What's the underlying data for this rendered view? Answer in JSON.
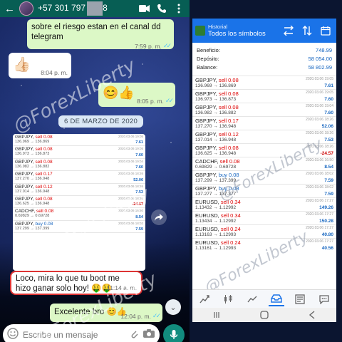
{
  "chat": {
    "header": {
      "phone": "+57 301 797",
      "phone_tail": "8"
    },
    "messages": [
      {
        "text": "sobre el riesgo estan en el canal dd telegram",
        "time": "7:59 p. m."
      },
      {
        "emoji": "👍🏻",
        "time": "8:04 p. m."
      },
      {
        "emoji": "😊👍",
        "time": "8:05 p. m."
      }
    ],
    "date_chip": "6 DE MARZO DE 2020",
    "screenshot_trades": [
      {
        "pair": "GBPJPY",
        "side": "sell 0.08",
        "prices": "136.969 → 136.869",
        "datetime": "2020.03.06 19:05",
        "profit": "7.61"
      },
      {
        "pair": "GBPJPY",
        "side": "sell 0.08",
        "prices": "136.973 → 136.873",
        "datetime": "2020.03.06 19:05",
        "profit": "7.60"
      },
      {
        "pair": "GBPJPY",
        "side": "sell 0.08",
        "prices": "136.982 → 136.882",
        "datetime": "2020.03.06 19:04",
        "profit": "7.60"
      },
      {
        "pair": "GBPJPY",
        "side": "sell 0.17",
        "prices": "137.270 → 136.948",
        "datetime": "2020.03.06 18:26",
        "profit": "52.06"
      },
      {
        "pair": "GBPJPY",
        "side": "sell 0.12",
        "prices": "137.014 → 136.948",
        "datetime": "2020.03.06 18:26",
        "profit": "7.53"
      },
      {
        "pair": "GBPJPY",
        "side": "sell 0.08",
        "prices": "136.625 → 136.948",
        "datetime": "2020.03.06 18:26",
        "profit": "-24.57"
      },
      {
        "pair": "CADCHF",
        "side": "sell 0.08",
        "prices": "0.69829 → 0.69728",
        "datetime": "2020.03.06 16:50",
        "profit": "8.54"
      },
      {
        "pair": "GBPJPY",
        "side": "buy 0.08",
        "prices": "137.299 → 137.399",
        "datetime": "2020.03.06 18:02",
        "profit": "7.59"
      }
    ],
    "reply": {
      "text": "Loco, mira lo que tu boot me hizo ganar solo hoy! 🤑🤑",
      "time": "11:14 a. m."
    },
    "answer": {
      "text": "Excelente bro 😊👍",
      "time": "12:04 p. m."
    },
    "input_placeholder": "Escribe un mensaje",
    "watermark": "@ForexLiberty"
  },
  "mt4": {
    "header": {
      "subtitle": "Historial",
      "title": "Todos los símbolos"
    },
    "summary": [
      {
        "label": "Beneficio:",
        "value": "748.99"
      },
      {
        "label": "Depósito:",
        "value": "58 054.00"
      },
      {
        "label": "Balance:",
        "value": "58 802.99"
      }
    ],
    "trades": [
      {
        "pair": "GBPJPY",
        "side": "sell 0.08",
        "prices": "136.969 → 136.869",
        "datetime": "2020.03.06 19:05",
        "profit": "7.61"
      },
      {
        "pair": "GBPJPY",
        "side": "sell 0.08",
        "prices": "136.973 → 136.873",
        "datetime": "2020.03.06 19:05",
        "profit": "7.60"
      },
      {
        "pair": "GBPJPY",
        "side": "sell 0.08",
        "prices": "136.982 → 136.882",
        "datetime": "2020.03.06 19:04",
        "profit": "7.60"
      },
      {
        "pair": "GBPJPY",
        "side": "sell 0.17",
        "prices": "137.270 → 136.948",
        "datetime": "2020.03.06 18:26",
        "profit": "52.06"
      },
      {
        "pair": "GBPJPY",
        "side": "sell 0.12",
        "prices": "137.014 → 136.948",
        "datetime": "2020.03.06 18:26",
        "profit": "7.53"
      },
      {
        "pair": "GBPJPY",
        "side": "sell 0.08",
        "prices": "136.625 → 136.948",
        "datetime": "2020.03.06 18:26",
        "profit": "-24.57"
      },
      {
        "pair": "CADCHF",
        "side": "sell 0.08",
        "prices": "0.69829 → 0.69728",
        "datetime": "2020.03.06 16:50",
        "profit": "8.54"
      },
      {
        "pair": "GBPJPY",
        "side": "buy 0.08",
        "prices": "137.299 → 137.399",
        "datetime": "2020.03.06 18:02",
        "profit": "7.59"
      },
      {
        "pair": "GBPJPY",
        "side": "buy 0.08",
        "prices": "137.277 → 137.377",
        "datetime": "2020.03.06 18:02",
        "profit": "7.59"
      },
      {
        "pair": "EURUSD",
        "side": "sell 0.34",
        "prices": "1.13432 → 1.12992",
        "datetime": "2020.03.06 17:27",
        "profit": "149.26"
      },
      {
        "pair": "EURUSD",
        "side": "sell 0.34",
        "prices": "1.13434 → 1.12992",
        "datetime": "2020.03.06 17:27",
        "profit": "150.28"
      },
      {
        "pair": "EURUSD",
        "side": "sell 0.24",
        "prices": "1.13163 → 1.12993",
        "datetime": "2020.03.06 17:27",
        "profit": "40.80"
      },
      {
        "pair": "EURUSD",
        "side": "sell 0.24",
        "prices": "1.13161 → 1.12993",
        "datetime": "2020.03.06 17:27",
        "profit": "40.56"
      }
    ]
  },
  "colors": {
    "whatsapp_header": "#075e54",
    "outgoing_bubble": "#dcf8c6",
    "mt4_header": "#1a73e8",
    "profit_blue": "#1565c0",
    "loss_red": "#cc0000"
  },
  "icons": [
    "back-arrow-icon",
    "video-call-icon",
    "phone-icon",
    "more-icon",
    "share-icon",
    "double-chevron-down-icon",
    "emoji-icon",
    "attach-icon",
    "camera-icon",
    "mic-icon",
    "sort-icon",
    "calendar-icon",
    "quotes-icon",
    "chart-icon",
    "trade-icon",
    "history-icon",
    "messages-icon",
    "back-icon",
    "home-icon",
    "recents-icon"
  ]
}
